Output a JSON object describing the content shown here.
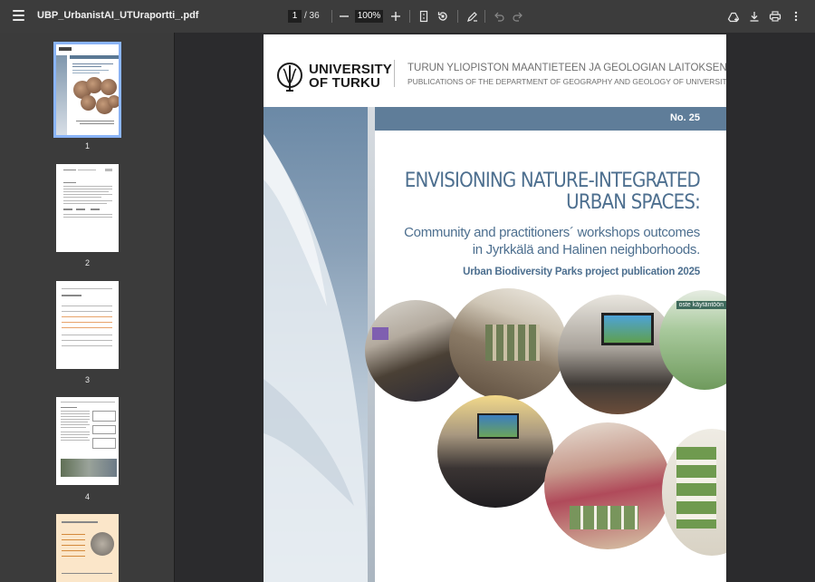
{
  "toolbar": {
    "file_name": "UBP_UrbanistAI_UTUraportti_.pdf",
    "current_page": "1",
    "page_total": "/ 36",
    "zoom": "100%"
  },
  "sidebar": {
    "thumbnails": [
      {
        "page": "1",
        "selected": true
      },
      {
        "page": "2",
        "selected": false
      },
      {
        "page": "3",
        "selected": false
      },
      {
        "page": "4",
        "selected": false
      }
    ]
  },
  "document": {
    "logo_line1": "UNIVERSITY",
    "logo_line2": "OF TURKU",
    "series_fi": "TURUN YLIOPISTON MAANTIETEEN JA GEOLOGIAN LAITOKSEN JULKAISUJA",
    "series_en": "PUBLICATIONS OF THE DEPARTMENT OF GEOGRAPHY AND GEOLOGY OF UNIVERSITY OF TURKU",
    "issue": "No. 25",
    "title_line1": "ENVISIONING NATURE-INTEGRATED",
    "title_line2": "URBAN SPACES:",
    "subtitle_line1": "Community and practitioners´ workshops outcomes",
    "subtitle_line2": "in Jyrkkälä and Halinen neighborhoods.",
    "publication_line": "Urban Biodiversity Parks project publication 2025",
    "photo_label": "oste käytäntöön"
  },
  "colors": {
    "accent_blue": "#5f7d99",
    "title_blue": "#4d6f8f",
    "toolbar_bg": "#3c3c3c",
    "viewer_bg": "#2b2b2d",
    "selection": "#8ab4f8"
  }
}
